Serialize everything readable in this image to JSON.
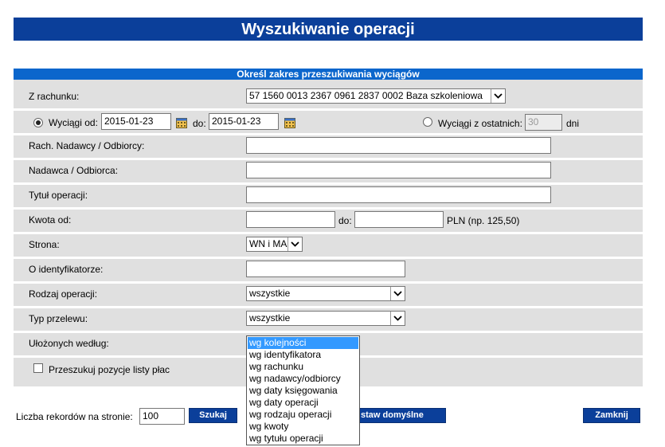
{
  "page": {
    "title": "Wyszukiwanie operacji"
  },
  "section": {
    "header": "Określ zakres przeszukiwania wyciągów"
  },
  "form": {
    "account_label": "Z rachunku:",
    "account_value": "57 1560 0013 2367 0961 2837 0002 Baza szkoleniowa",
    "radio_from_label": "Wyciągi od:",
    "date_from": "2015-01-23",
    "date_to_label": "do:",
    "date_to": "2015-01-23",
    "radio_last_label": "Wyciągi z ostatnich:",
    "last_days_value": "30",
    "days_label": "dni",
    "payer_account_label": "Rach. Nadawcy / Odbiorcy:",
    "payer_label": "Nadawca / Odbiorca:",
    "title_label": "Tytuł operacji:",
    "amount_from_label": "Kwota od:",
    "amount_to_label": "do:",
    "amount_hint": "PLN (np. 125,50)",
    "side_label": "Strona:",
    "side_value": "WN i MA",
    "identifier_label": "O identyfikatorze:",
    "operation_type_label": "Rodzaj operacji:",
    "operation_type_value": "wszystkie",
    "transfer_type_label": "Typ przelewu:",
    "transfer_type_value": "wszystkie",
    "sort_label": "Ułożonych według:",
    "payroll_label": "Przeszukuj pozycje listy płac"
  },
  "sort_options": [
    "wg kolejności",
    "wg identyfikatora",
    "wg rachunku",
    "wg nadawcy/odbiorcy",
    "wg daty księgowania",
    "wg daty operacji",
    "wg rodzaju operacji",
    "wg kwoty",
    "wg tytułu operacji"
  ],
  "sort_selected_index": 0,
  "footer": {
    "records_label": "Liczba rekordów na stronie:",
    "records_value": "100",
    "search_button": "Szukaj",
    "defaults_button": "stаw domyślne",
    "close_button": "Zamknij"
  },
  "colors": {
    "banner": "#0b3f9a",
    "section_header": "#0b66cc",
    "panel": "#e0e0e0",
    "dropdown_selection": "#3399ff"
  }
}
